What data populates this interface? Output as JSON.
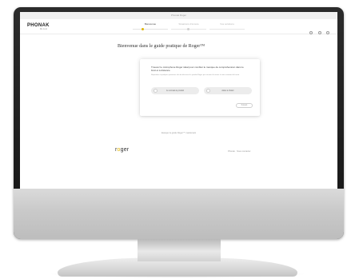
{
  "browser": {
    "topbar_label": "Phonak Roger"
  },
  "site": {
    "logo_text": "PHONAK",
    "logo_subtext": "life is on",
    "steps": [
      {
        "label": "Bienvenue",
        "active": true
      },
      {
        "label": "Situations d'écoute",
        "active": false
      },
      {
        "label": "Vos solutions",
        "active": false
      }
    ],
    "header_icons": [
      "search-icon",
      "user-icon",
      "globe-icon"
    ]
  },
  "main": {
    "title": "Bienvenue dans le guide pratique de Roger™",
    "dialog": {
      "question": "Trouvez le microphone Roger idéal pour combler le manque de compréhension dans le bruit et à distance",
      "description": "Répondez à quelques questions afin de découvrir le produit Roger qui convient le mieux à votre situation d'écoute.",
      "options": [
        {
          "label": "Je connais le produit",
          "icon": "ear-icon"
        },
        {
          "label": "Aider à choisir",
          "icon": "hand-icon"
        }
      ],
      "next_label": "Suivant"
    },
    "try_link": "Essayer le guide Roger™ maintenant"
  },
  "footer": {
    "brand_before": "r",
    "brand_accent": "o",
    "brand_after": "ger",
    "links": "Phonak · Nous contacter"
  },
  "colors": {
    "accent": "#e0b400",
    "monitor_bezel": "#1c1c1c",
    "monitor_chin": "#cfcfcf"
  }
}
